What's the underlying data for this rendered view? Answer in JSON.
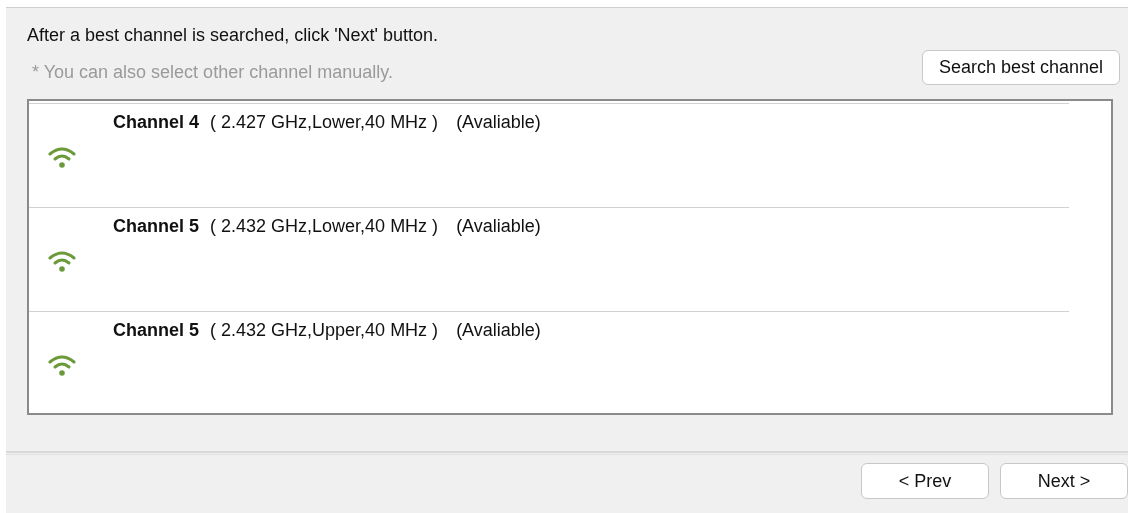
{
  "instruction": "After a best channel is searched, click 'Next' button.",
  "hint": "* You can also select other channel manually.",
  "search_button": "Search best channel",
  "channels": [
    {
      "name": "Channel 4",
      "detail": "( 2.427 GHz,Lower,40 MHz )",
      "status": "(Avaliable)"
    },
    {
      "name": "Channel 5",
      "detail": "( 2.432 GHz,Lower,40 MHz )",
      "status": "(Avaliable)"
    },
    {
      "name": "Channel 5",
      "detail": "( 2.432 GHz,Upper,40 MHz )",
      "status": "(Avaliable)"
    }
  ],
  "buttons": [
    "< Prev",
    "Next >"
  ]
}
